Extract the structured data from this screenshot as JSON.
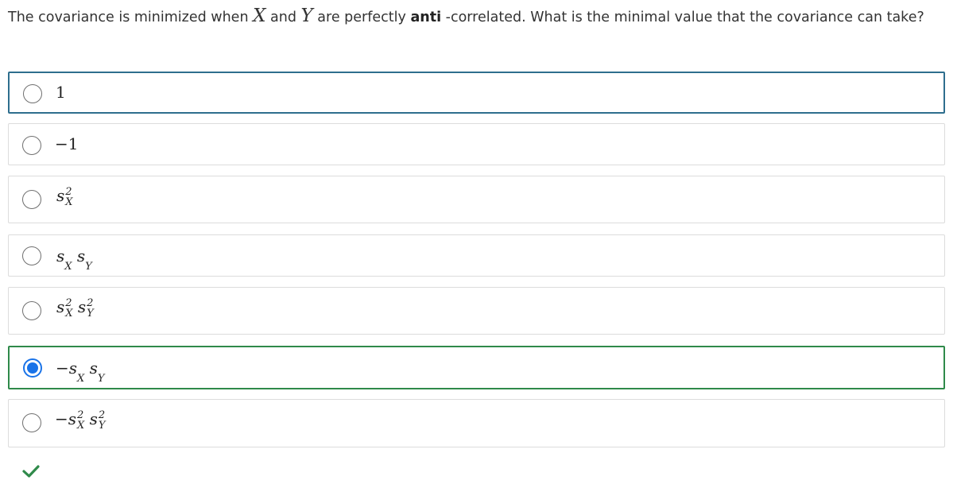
{
  "question": {
    "text_before": "The covariance is minimized when ",
    "var_x": "X",
    "text_and": " and ",
    "var_y": "Y",
    "text_are": " are perfectly ",
    "bold_word": "anti",
    "text_after": " -correlated. What is the minimal value that the covariance can take?"
  },
  "options": [
    {
      "label": "1",
      "selected": false
    },
    {
      "label": "−1",
      "selected": false
    },
    {
      "label": "s_X^2",
      "selected": false
    },
    {
      "label": "s_X s_Y",
      "selected": false
    },
    {
      "label": "s_X^2 s_Y^2",
      "selected": false
    },
    {
      "label": "−s_X s_Y",
      "selected": true
    },
    {
      "label": "−s_X^2 s_Y^2",
      "selected": false
    }
  ],
  "math": {
    "minus": "−",
    "one": "1",
    "s": "s",
    "sub_x": "X",
    "sub_y": "Y",
    "exp_2": "2"
  },
  "feedback": {
    "icon": "checkmark-icon",
    "color": "#2f8a4a",
    "status": "correct"
  },
  "colors": {
    "selected_radio": "#1a73e8",
    "correct_border": "#2f8a4a",
    "focus_border": "#2e6e8e"
  }
}
